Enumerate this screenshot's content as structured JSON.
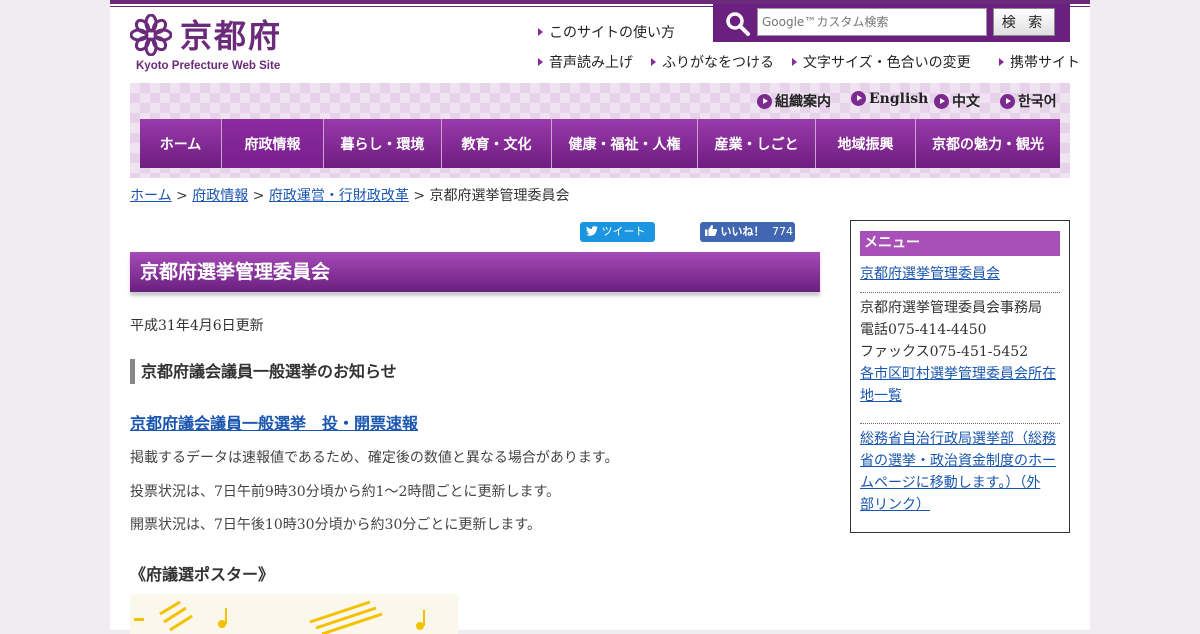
{
  "header": {
    "logo_jp": "京都府",
    "logo_en": "Kyoto Prefecture Web Site",
    "search_placeholder": "Google™カスタム検索",
    "search_button": "検 索",
    "util_links": [
      "このサイトの使い方",
      "音声読み上げ",
      "ふりがなをつける",
      "文字サイズ・色合いの変更",
      "携帯サイト"
    ]
  },
  "languages": [
    "組織案内",
    "English",
    "中文",
    "한국어"
  ],
  "nav": [
    "ホーム",
    "府政情報",
    "暮らし・環境",
    "教育・文化",
    "健康・福祉・人権",
    "産業・しごと",
    "地域振興",
    "京都の魅力・観光"
  ],
  "breadcrumb": {
    "items": [
      "ホーム",
      "府政情報",
      "府政運営・行財政改革"
    ],
    "separator": ">",
    "current": "京都府選挙管理委員会"
  },
  "social": {
    "tweet": "ツイート",
    "like": "いいね！",
    "like_count": "774"
  },
  "main": {
    "title": "京都府選挙管理委員会",
    "updated": "平成31年4月6日更新",
    "section_heading": "京都府議会議員一般選挙のお知らせ",
    "link_heading": "京都府議会議員一般選挙　投・開票速報",
    "paragraphs": [
      "掲載するデータは速報値であるため、確定後の数値と異なる場合があります。",
      "投票状況は、7日午前9時30分頃から約1～2時間ごとに更新します。",
      "開票状況は、7日午後10時30分頃から約30分ごとに更新します。"
    ],
    "poster_heading": "《府議選ポスター》"
  },
  "side": {
    "heading": "メニュー",
    "link1": "京都府選挙管理委員会",
    "office": "京都府選挙管理委員会事務局",
    "tel": "電話075-414-4450",
    "fax": "ファックス075-451-5452",
    "link2_line1": "各市区町村選挙管理委員会所在",
    "link2_line2": "地一覧",
    "link3_lines": [
      "総務省自治行政局選挙部（総務",
      "省の選挙・政治資金制度のホー",
      "ムページに移動します。）（外",
      "部リンク）"
    ]
  },
  "colors": {
    "brand": "#6b1f7f",
    "link": "#1a56b0",
    "side_head": "#a950b8"
  }
}
